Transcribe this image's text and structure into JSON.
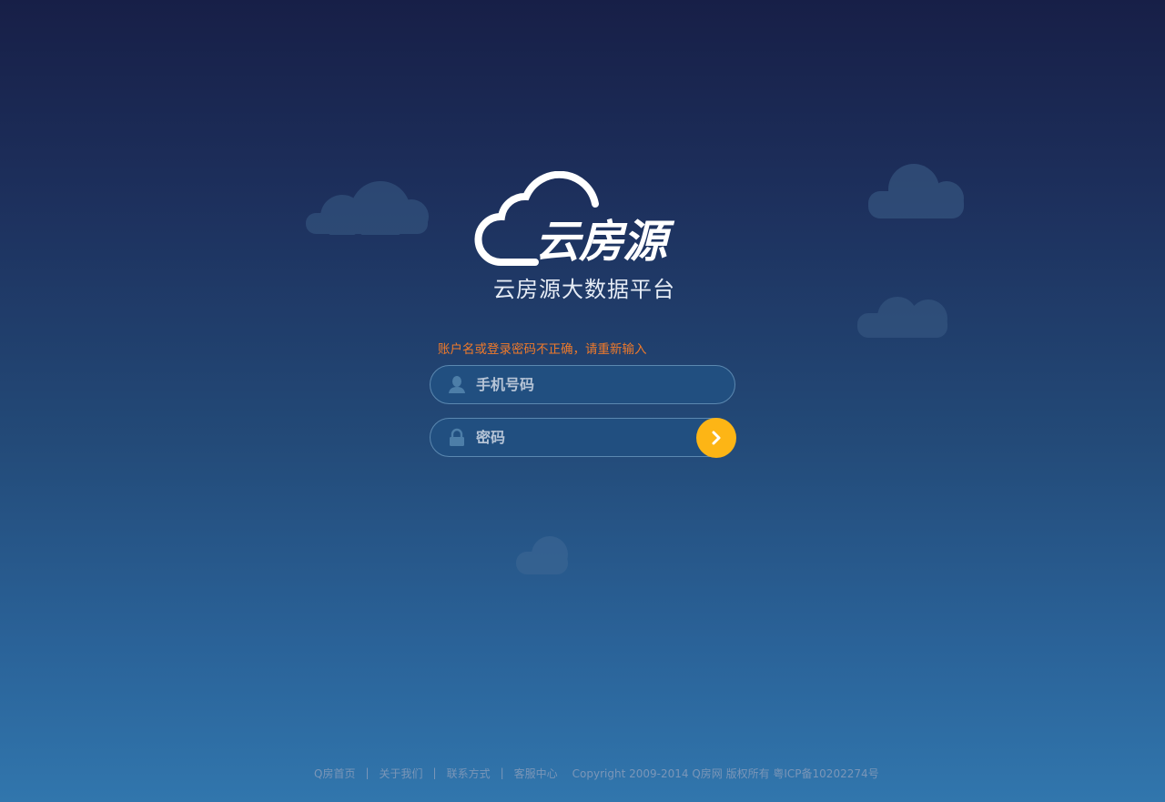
{
  "brand": {
    "name": "云房源",
    "subtitle": "云房源大数据平台"
  },
  "login": {
    "error_message": "账户名或登录密码不正确，请重新输入",
    "phone_placeholder": "手机号码",
    "password_placeholder": "密码"
  },
  "footer": {
    "links": [
      "Q房首页",
      "关于我们",
      "联系方式",
      "客服中心"
    ],
    "separator": "|",
    "copyright": "Copyright 2009-2014  Q房网  版权所有  粤ICP备10202274号"
  },
  "colors": {
    "error": "#f07a2a",
    "submit_button": "#fdb515",
    "background_top": "#171f47",
    "background_bottom": "#3176ad"
  },
  "icons": {
    "logo": "cloud-logo-icon",
    "phone_field": "user-icon",
    "password_field": "lock-icon",
    "submit": "chevron-right-icon"
  }
}
